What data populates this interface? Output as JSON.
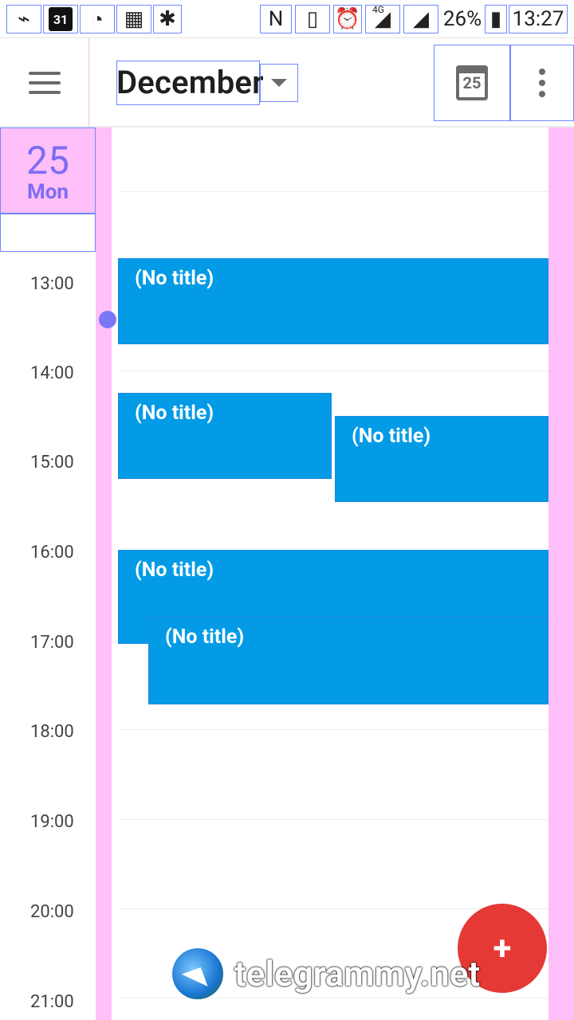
{
  "status_bar": {
    "battery_percent": "26%",
    "time": "13:27",
    "calendar_day": "31",
    "network": "4G"
  },
  "app_bar": {
    "title": "December",
    "today_day": "25"
  },
  "day_header": {
    "day_number": "25",
    "weekday": "Mon"
  },
  "time_labels": [
    "13:00",
    "14:00",
    "15:00",
    "16:00",
    "17:00",
    "18:00",
    "19:00",
    "20:00",
    "21:00"
  ],
  "events": [
    {
      "title": "(No title)"
    },
    {
      "title": "(No title)"
    },
    {
      "title": "(No title)"
    },
    {
      "title": "(No title)"
    },
    {
      "title": "(No title)"
    }
  ],
  "fab": {
    "label": "+"
  },
  "watermark": {
    "text": "telegrammy.net"
  }
}
